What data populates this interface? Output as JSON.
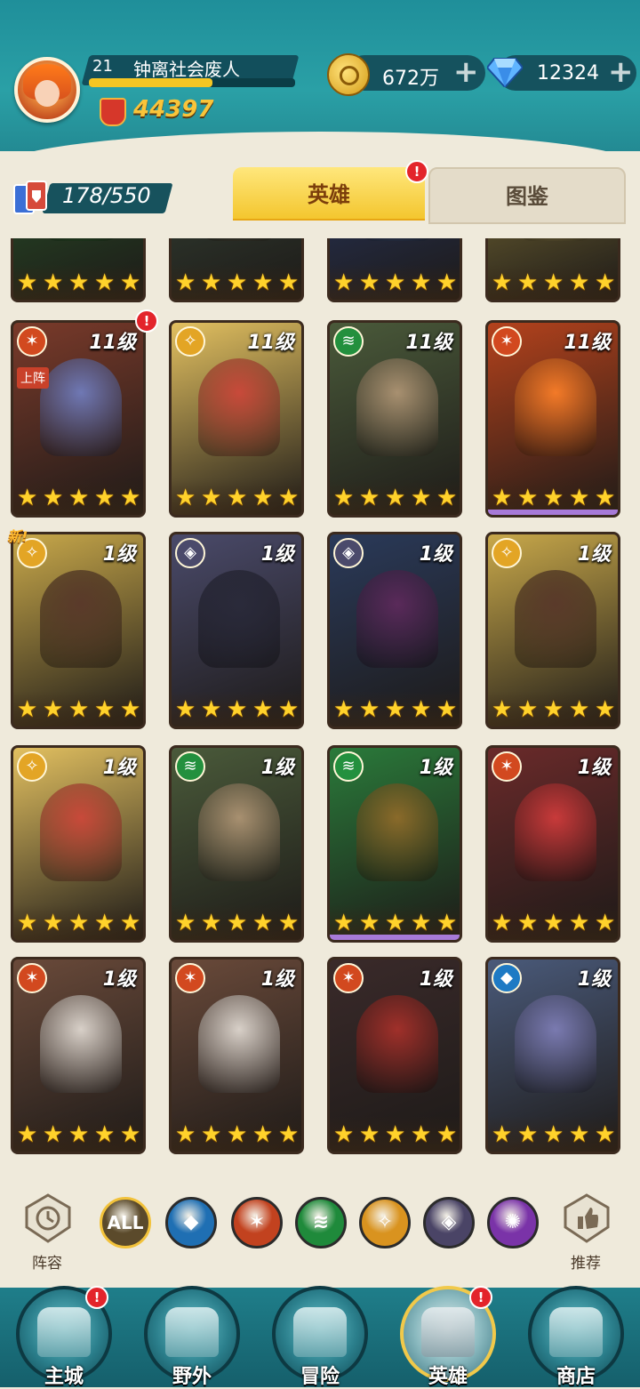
{
  "player": {
    "level": "21",
    "name": "钟离社会废人",
    "xp_fraction": 0.6,
    "power": "44397"
  },
  "resources": {
    "gold": "672万",
    "gems": "12324"
  },
  "hero_count": "178/550",
  "tabs": [
    {
      "label": "英雄",
      "active": true,
      "badge": "!"
    },
    {
      "label": "图鉴",
      "active": false
    }
  ],
  "cards": [
    {
      "level": "",
      "element": "fire",
      "stars": 5,
      "bg": "#2a5a2a",
      "figure": "#3a8a3a",
      "partial": true
    },
    {
      "level": "",
      "element": "green",
      "stars": 5,
      "bg": "#3a4a3a",
      "figure": "#7a6a50",
      "partial": true
    },
    {
      "level": "",
      "element": "water",
      "stars": 5,
      "bg": "#2a3a6a",
      "figure": "#5a7ab0",
      "partial": true
    },
    {
      "level": "",
      "element": "light",
      "stars": 5,
      "bg": "#8a7a3a",
      "figure": "#d9c070",
      "partial": true
    },
    {
      "level": "11级",
      "element": "fire",
      "stars": 5,
      "bg": "#7a3a2a",
      "figure": "#6f78b4",
      "tag": "上阵",
      "badge": "!"
    },
    {
      "level": "11级",
      "element": "light",
      "stars": 5,
      "bg": "#e2c060",
      "figure": "#c84a3a"
    },
    {
      "level": "11级",
      "element": "green",
      "stars": 5,
      "bg": "#4a5a3a",
      "figure": "#a89070"
    },
    {
      "level": "11级",
      "element": "fire",
      "stars": 5,
      "bg": "#b4421c",
      "figure": "#f37a28",
      "rarity": "#a77ad8"
    },
    {
      "level": "1级",
      "element": "light",
      "stars": 5,
      "bg": "#c8a84a",
      "figure": "#5a3a2a",
      "new": "新!"
    },
    {
      "level": "1级",
      "element": "dark",
      "stars": 5,
      "bg": "#4a4a6a",
      "figure": "#2a2a3a"
    },
    {
      "level": "1级",
      "element": "dark",
      "stars": 5,
      "bg": "#2a3a5a",
      "figure": "#5a2a5a"
    },
    {
      "level": "1级",
      "element": "light",
      "stars": 5,
      "bg": "#c8a84a",
      "figure": "#5a3a2a"
    },
    {
      "level": "1级",
      "element": "light",
      "stars": 5,
      "bg": "#e2c060",
      "figure": "#c84a3a"
    },
    {
      "level": "1级",
      "element": "green",
      "stars": 5,
      "bg": "#4a5a3a",
      "figure": "#a89070"
    },
    {
      "level": "1级",
      "element": "green",
      "stars": 5,
      "bg": "#2a7a3a",
      "figure": "#8a6a2a",
      "rarity": "#a77ad8"
    },
    {
      "level": "1级",
      "element": "fire",
      "stars": 5,
      "bg": "#6a2a2a",
      "figure": "#c83a3a"
    },
    {
      "level": "1级",
      "element": "fire",
      "stars": 5,
      "bg": "#6a4a3a",
      "figure": "#d8d0c8"
    },
    {
      "level": "1级",
      "element": "fire",
      "stars": 5,
      "bg": "#6a4a3a",
      "figure": "#d8d0c8"
    },
    {
      "level": "1级",
      "element": "fire",
      "stars": 5,
      "bg": "#3a2a2a",
      "figure": "#a0302a"
    },
    {
      "level": "1级",
      "element": "water",
      "stars": 5,
      "bg": "#4a5a7a",
      "figure": "#7a7ab0"
    }
  ],
  "filters": {
    "left_label": "阵容",
    "right_label": "推荐",
    "buttons": [
      {
        "id": "all",
        "label": "ALL",
        "color": "#5b4a2b"
      },
      {
        "id": "water",
        "label": "",
        "color": "#1f6fb3"
      },
      {
        "id": "fire",
        "label": "",
        "color": "#c2421f"
      },
      {
        "id": "green",
        "label": "",
        "color": "#1f8a3b"
      },
      {
        "id": "light",
        "label": "",
        "color": "#d9931f"
      },
      {
        "id": "dark",
        "label": "",
        "color": "#4a4466"
      },
      {
        "id": "arcane",
        "label": "",
        "color": "#7a33a8"
      }
    ]
  },
  "nav": [
    {
      "label": "主城",
      "badge": "!"
    },
    {
      "label": "野外"
    },
    {
      "label": "冒险"
    },
    {
      "label": "英雄",
      "active": true,
      "badge": "!"
    },
    {
      "label": "商店"
    }
  ],
  "colors": {
    "fire": "#d2491f",
    "water": "#1e7ac4",
    "green": "#23903e",
    "light": "#e3a525",
    "dark": "#4b4a6b"
  }
}
